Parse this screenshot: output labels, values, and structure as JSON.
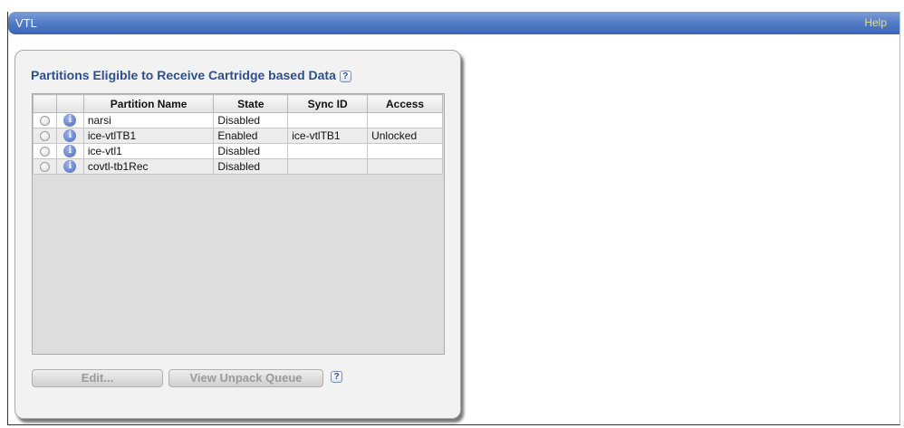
{
  "window": {
    "title": "VTL",
    "help_label": "Help"
  },
  "panel": {
    "title": "Partitions Eligible to Receive Cartridge based Data",
    "help_icon": "?"
  },
  "table": {
    "columns": [
      "",
      "",
      "Partition Name",
      "State",
      "Sync ID",
      "Access"
    ],
    "rows": [
      {
        "partition_name": "narsi",
        "state": "Disabled",
        "sync_id": "",
        "access": ""
      },
      {
        "partition_name": "ice-vtlTB1",
        "state": "Enabled",
        "sync_id": "ice-vtlTB1",
        "access": "Unlocked"
      },
      {
        "partition_name": "ice-vtl1",
        "state": "Disabled",
        "sync_id": "",
        "access": ""
      },
      {
        "partition_name": "covtl-tb1Rec",
        "state": "Disabled",
        "sync_id": "",
        "access": ""
      }
    ]
  },
  "buttons": {
    "edit": "Edit...",
    "view_unpack_queue": "View Unpack Queue",
    "help_icon": "?"
  },
  "icons": {
    "info": "i",
    "colors": {
      "title_bar": "#4f78c4",
      "help_link": "#e8e07a",
      "panel_title": "#2c4f8f"
    }
  }
}
